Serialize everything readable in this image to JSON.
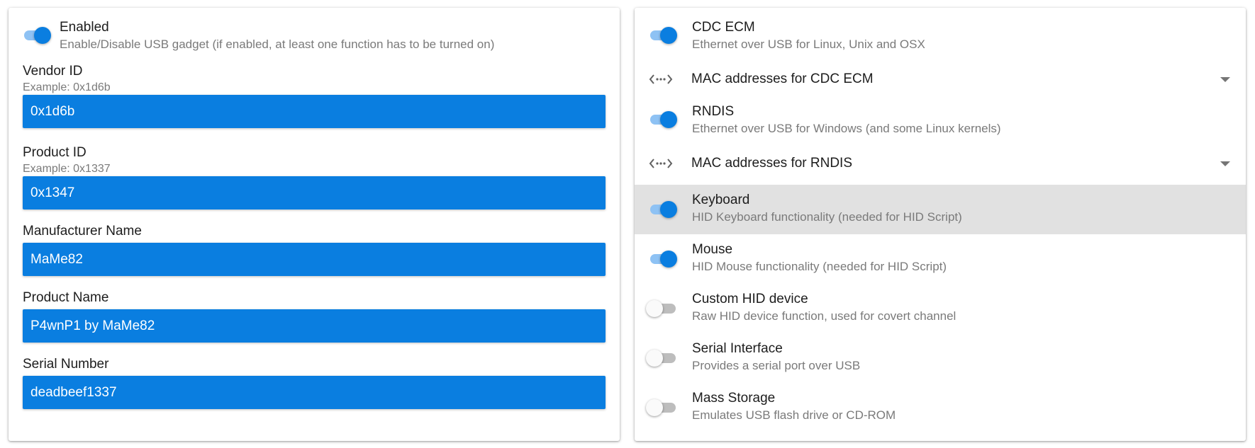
{
  "usb_settings": {
    "enabled": {
      "title": "Enabled",
      "subtitle": "Enable/Disable USB gadget (if enabled, at least one function has to be turned on)",
      "on": true
    },
    "vendor_id": {
      "label": "Vendor ID",
      "hint": "Example: 0x1d6b",
      "value": "0x1d6b"
    },
    "product_id": {
      "label": "Product ID",
      "hint": "Example: 0x1337",
      "value": "0x1347"
    },
    "manufacturer_name": {
      "label": "Manufacturer Name",
      "value": "MaMe82"
    },
    "product_name": {
      "label": "Product Name",
      "value": "P4wnP1 by MaMe82"
    },
    "serial_number": {
      "label": "Serial Number",
      "value": "deadbeef1337"
    }
  },
  "functions": {
    "cdc_ecm": {
      "title": "CDC ECM",
      "subtitle": "Ethernet over USB for Linux, Unix and OSX",
      "on": true
    },
    "cdc_ecm_mac": {
      "label": "MAC addresses for CDC ECM",
      "icon": "code-arrows-icon"
    },
    "rndis": {
      "title": "RNDIS",
      "subtitle": "Ethernet over USB for Windows (and some Linux kernels)",
      "on": true
    },
    "rndis_mac": {
      "label": "MAC addresses for RNDIS",
      "icon": "code-arrows-icon"
    },
    "keyboard": {
      "title": "Keyboard",
      "subtitle": "HID Keyboard functionality (needed for HID Script)",
      "on": true,
      "highlighted": true
    },
    "mouse": {
      "title": "Mouse",
      "subtitle": "HID Mouse functionality (needed for HID Script)",
      "on": true
    },
    "custom_hid": {
      "title": "Custom HID device",
      "subtitle": "Raw HID device function, used for covert channel",
      "on": false
    },
    "serial": {
      "title": "Serial Interface",
      "subtitle": "Provides a serial port over USB",
      "on": false
    },
    "mass_storage": {
      "title": "Mass Storage",
      "subtitle": "Emulates USB flash drive or CD-ROM",
      "on": false
    }
  },
  "colors": {
    "accent": "#0a7ee0",
    "toggle_track_on": "#8ec2f4",
    "highlight_row": "#e1e1e1"
  }
}
